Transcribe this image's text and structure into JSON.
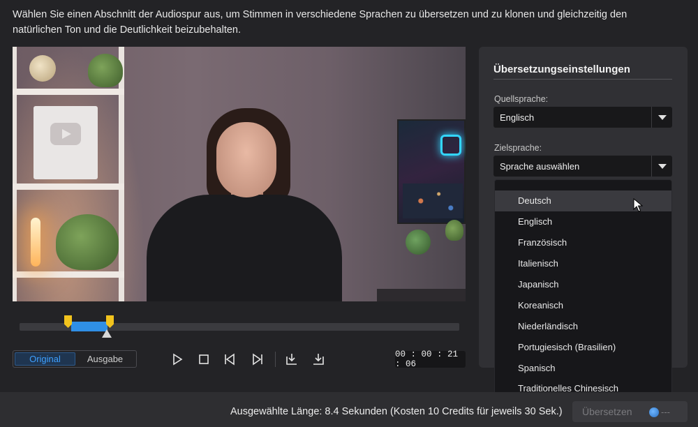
{
  "instruction": {
    "line1": "Wählen Sie einen Abschnitt der Audiospur aus, um Stimmen in verschiedene Sprachen zu übersetzen und zu klonen und gleichzeitig den",
    "line2": "natürlichen Ton und die Deutlichkeit beizubehalten."
  },
  "playback": {
    "toggle": {
      "original_label": "Original",
      "output_label": "Ausgabe",
      "active": "Original"
    },
    "timecode": "00 : 00 : 21 : 06",
    "controls": [
      "play-icon",
      "stop-icon",
      "previous-frame-icon",
      "next-frame-icon",
      "mark-in-icon",
      "mark-out-icon"
    ]
  },
  "settings": {
    "title": "Übersetzungseinstellungen",
    "source_label": "Quellsprache:",
    "source_value": "Englisch",
    "target_label": "Zielsprache:",
    "target_value": "Sprache auswählen",
    "languages": [
      "Deutsch",
      "Englisch",
      "Französisch",
      "Italienisch",
      "Japanisch",
      "Koreanisch",
      "Niederländisch",
      "Portugiesisch (Brasilien)",
      "Spanisch",
      "Traditionelles Chinesisch"
    ],
    "hovered_language": "Deutsch"
  },
  "footer": {
    "summary": "Ausgewählte Länge: 8.4 Sekunden (Kosten 10 Credits für jeweils 30 Sek.)",
    "translate_label": "Übersetzen",
    "credit_value": "---"
  },
  "colors": {
    "accent": "#2f8fe5",
    "handle": "#f2c31d",
    "panel": "#303034",
    "background": "#232326"
  }
}
